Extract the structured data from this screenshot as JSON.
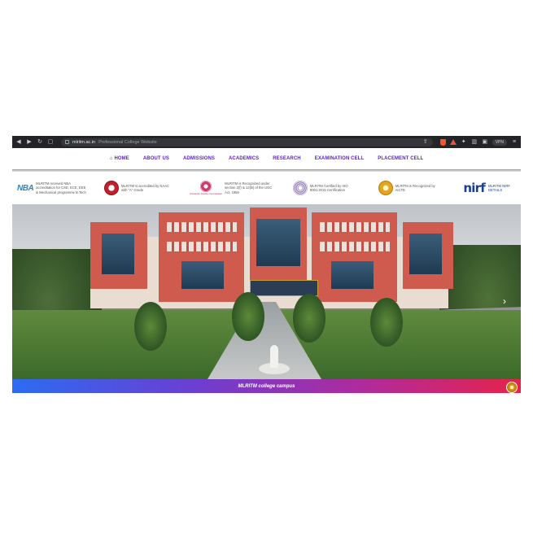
{
  "browser": {
    "url": "mlritm.ac.in",
    "page_title": "Professional College Website",
    "vpn_label": "VPN"
  },
  "nav": {
    "items": [
      {
        "label": "HOME",
        "icon": "home-icon"
      },
      {
        "label": "ABOUT US"
      },
      {
        "label": "ADMISSIONS"
      },
      {
        "label": "ACADEMICS"
      },
      {
        "label": "RESEARCH"
      },
      {
        "label": "EXAMINATION CELL"
      },
      {
        "label": "PLACEMENT CELL"
      }
    ]
  },
  "accreditations": [
    {
      "logo": "NBA",
      "text": "MLRITM received NBA accreditation for CSE, ECE, EEE & Mechanical programme B.Tech"
    },
    {
      "logo": "naac-seal",
      "text": "MLRITM is accredited by NAAC with \"A\" Grade"
    },
    {
      "logo": "ugc-seal",
      "logo_caption": "University Grants Commission",
      "text": "MLRITM is Recognized under section 2(f) & 12(B) of the UGC Act, 1956"
    },
    {
      "logo": "iso-seal",
      "text": "MLRITM Certified by ISO 9001:2015 Certification"
    },
    {
      "logo": "aicte-seal",
      "text": "MLRITM is Recognized by AICTE"
    },
    {
      "logo": "nirf",
      "text": "MLRITM NIRF DETAILS"
    }
  ],
  "hero": {
    "caption": "MLRITM college campus",
    "next_icon": "chevron-right-icon"
  },
  "colors": {
    "nav_text": "#5b1ec9",
    "caption_gradient_start": "#2b6cf2",
    "caption_gradient_end": "#e6234a",
    "building_red": "#cf5a4e"
  }
}
